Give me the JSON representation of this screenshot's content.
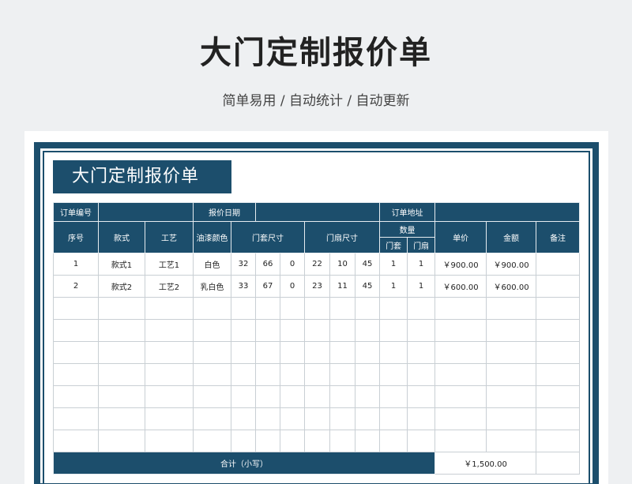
{
  "header": {
    "title": "大门定制报价单",
    "subtitle": "简单易用 / 自动统计 / 自动更新"
  },
  "document": {
    "title": "大门定制报价单",
    "info_row": {
      "order_no_label": "订单编号",
      "order_no_value": "",
      "quote_date_label": "报价日期",
      "quote_date_value": "",
      "address_label": "订单地址",
      "address_value": ""
    },
    "columns": {
      "index": "序号",
      "style": "款式",
      "craft": "工艺",
      "paint_color": "油漆颜色",
      "door_frame_size": "门套尺寸",
      "door_leaf_size": "门扇尺寸",
      "quantity": "数量",
      "qty_frame": "门套",
      "qty_leaf": "门扇",
      "unit_price": "单价",
      "amount": "金额",
      "remark": "备注"
    },
    "rows": [
      {
        "index": "1",
        "style": "款式1",
        "craft": "工艺1",
        "color": "白色",
        "f1": "32",
        "f2": "66",
        "f3": "0",
        "l1": "22",
        "l2": "10",
        "l3": "45",
        "qf": "1",
        "ql": "1",
        "price": "￥900.00",
        "amount": "￥900.00",
        "remark": ""
      },
      {
        "index": "2",
        "style": "款式2",
        "craft": "工艺2",
        "color": "乳白色",
        "f1": "33",
        "f2": "67",
        "f3": "0",
        "l1": "23",
        "l2": "11",
        "l3": "45",
        "qf": "1",
        "ql": "1",
        "price": "￥600.00",
        "amount": "￥600.00",
        "remark": ""
      }
    ],
    "total": {
      "label": "合计（小写）",
      "value": "￥1,500.00"
    }
  }
}
